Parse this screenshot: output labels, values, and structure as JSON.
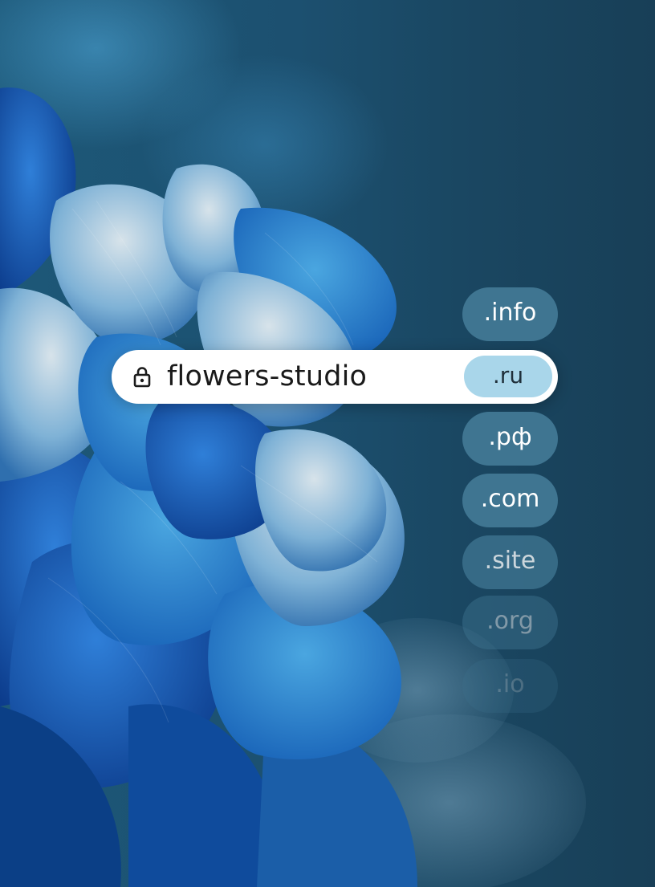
{
  "address_bar": {
    "url_text": "flowers-studio",
    "lock_icon": "lock-icon"
  },
  "domain_options": [
    {
      "label": ".info",
      "selected": false
    },
    {
      "label": ".ru",
      "selected": true
    },
    {
      "label": ".рф",
      "selected": false
    },
    {
      "label": ".com",
      "selected": false
    },
    {
      "label": ".site",
      "selected": false
    },
    {
      "label": ".org",
      "selected": false
    },
    {
      "label": ".io",
      "selected": false
    }
  ],
  "colors": {
    "background": "#1b4a63",
    "pill": "#3f7591",
    "selected_pill": "#a9d6ea",
    "address_bar": "#ffffff"
  }
}
